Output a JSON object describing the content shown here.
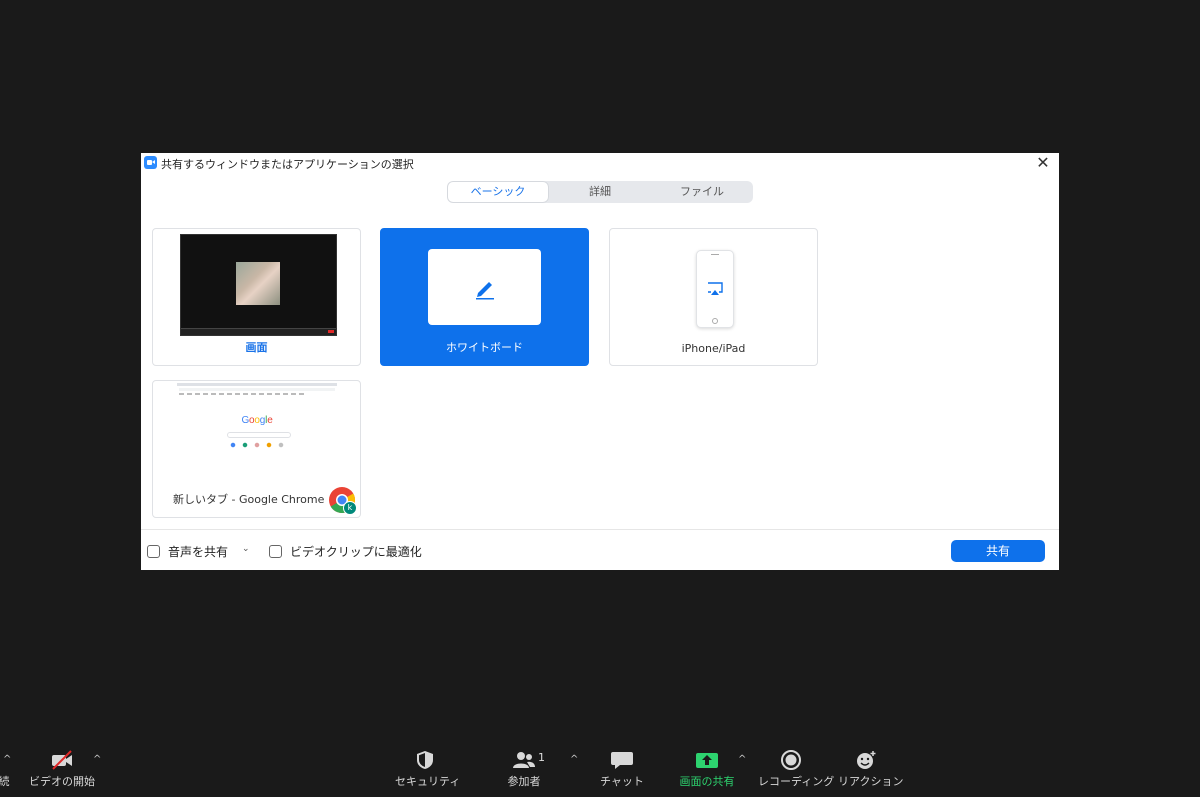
{
  "dialog": {
    "title": "共有するウィンドウまたはアプリケーションの選択",
    "close_glyph": "✕",
    "tabs": [
      {
        "label": "ベーシック",
        "active": true
      },
      {
        "label": "詳細",
        "active": false
      },
      {
        "label": "ファイル",
        "active": false
      }
    ],
    "sources": [
      {
        "label": "画面",
        "kind": "screen"
      },
      {
        "label": "ホワイトボード",
        "kind": "whiteboard",
        "selected": true
      },
      {
        "label": "iPhone/iPad",
        "kind": "device"
      },
      {
        "label": "新しいタブ - Google Chrome",
        "kind": "window",
        "thumb_brand": "Google",
        "badge": "k"
      }
    ],
    "options": {
      "share_audio": {
        "label": "音声を共有",
        "checked": false
      },
      "optimize_video": {
        "label": "ビデオクリップに最適化",
        "checked": false
      }
    },
    "dropdown_caret": "⌄",
    "share_button": "共有"
  },
  "toolbar": {
    "items": [
      {
        "label": "続",
        "icon": "mic-icon"
      },
      {
        "label": "ビデオの開始",
        "icon": "video-off-icon"
      },
      {
        "label": "セキュリティ",
        "icon": "shield-icon"
      },
      {
        "label": "参加者",
        "icon": "participants-icon",
        "count": "1"
      },
      {
        "label": "チャット",
        "icon": "chat-icon"
      },
      {
        "label": "画面の共有",
        "icon": "share-screen-icon",
        "active": true
      },
      {
        "label": "レコーディング",
        "icon": "record-icon"
      },
      {
        "label": "リアクション",
        "icon": "reaction-icon"
      }
    ],
    "caret": "^"
  },
  "colors": {
    "accent": "#0e71eb",
    "background": "#1a1a1a",
    "share_active": "#2dd36f"
  }
}
